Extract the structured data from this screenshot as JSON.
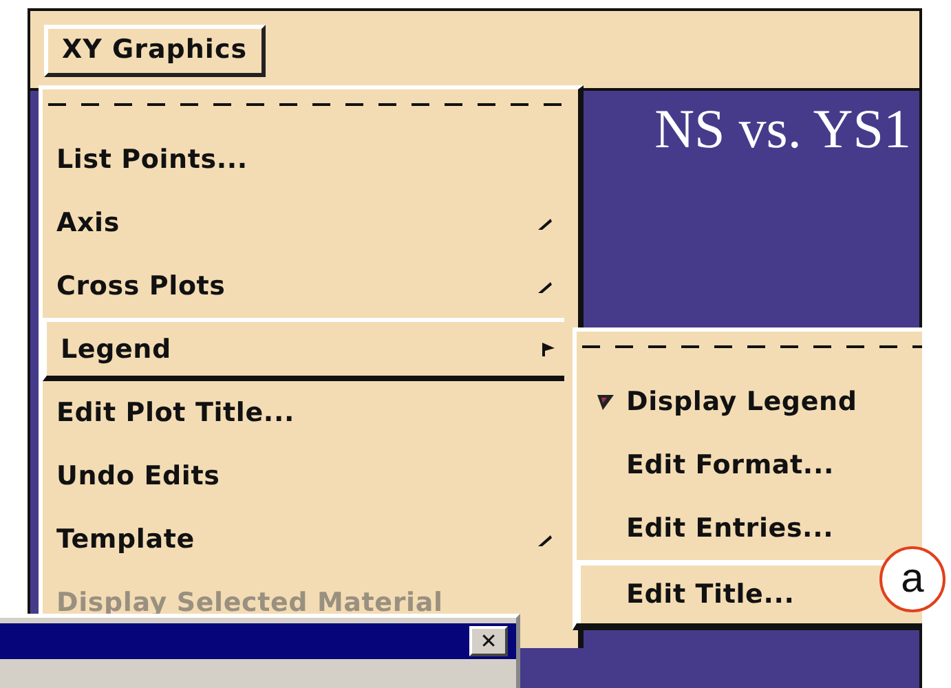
{
  "menubar": {
    "label": "XY Graphics"
  },
  "plot": {
    "title": "NS vs. YS1"
  },
  "menu": {
    "items": [
      {
        "label": "List Points...",
        "submenu": false,
        "selected": false,
        "disabled": false
      },
      {
        "label": "Axis",
        "submenu": true,
        "selected": false,
        "disabled": false
      },
      {
        "label": "Cross Plots",
        "submenu": true,
        "selected": false,
        "disabled": false
      },
      {
        "label": "Legend",
        "submenu": true,
        "selected": true,
        "disabled": false
      },
      {
        "label": "Edit Plot Title...",
        "submenu": false,
        "selected": false,
        "disabled": false
      },
      {
        "label": "Undo Edits",
        "submenu": false,
        "selected": false,
        "disabled": false
      },
      {
        "label": "Template",
        "submenu": true,
        "selected": false,
        "disabled": false
      },
      {
        "label": "Display Selected Material",
        "submenu": false,
        "selected": false,
        "disabled": true
      }
    ]
  },
  "submenu": {
    "items": [
      {
        "label": "Display Legend",
        "checked": true,
        "selected": false
      },
      {
        "label": "Edit Format...",
        "checked": false,
        "selected": false
      },
      {
        "label": "Edit Entries...",
        "checked": false,
        "selected": false
      },
      {
        "label": "Edit Title...",
        "checked": false,
        "selected": true
      }
    ]
  },
  "dialog": {
    "close": "✕"
  },
  "callout": {
    "label": "a"
  }
}
